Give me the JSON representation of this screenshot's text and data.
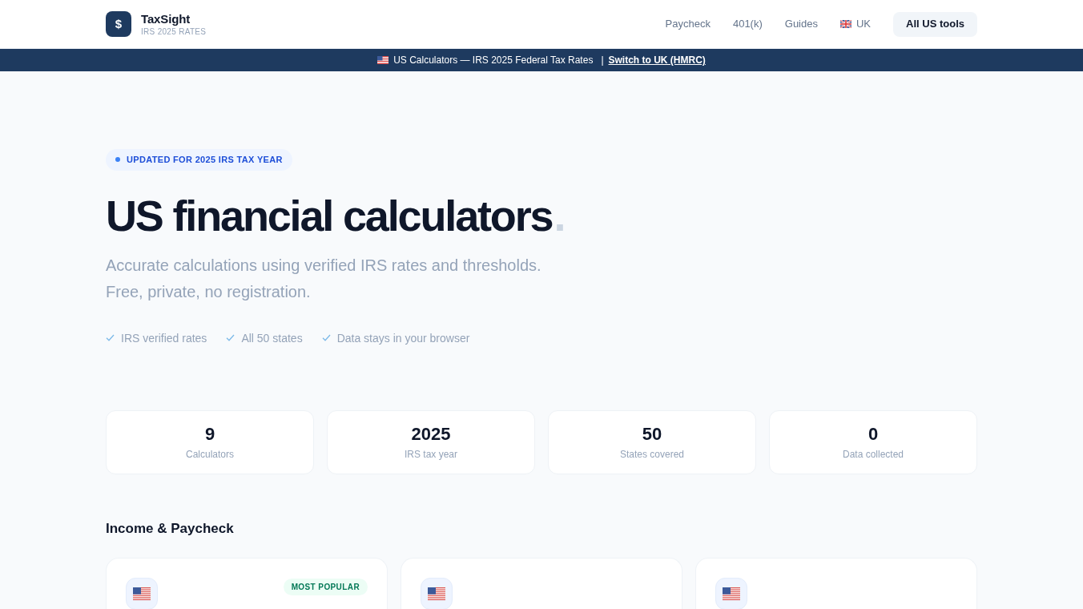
{
  "header": {
    "logo": {
      "symbol": "$",
      "name": "TaxSight",
      "tagline": "IRS 2025 RATES"
    },
    "nav": [
      {
        "label": "Paycheck",
        "kind": "link"
      },
      {
        "label": "401(k)",
        "kind": "link"
      },
      {
        "label": "Guides",
        "kind": "link"
      },
      {
        "label": "UK",
        "kind": "flag_link"
      },
      {
        "label": "All US tools",
        "kind": "button"
      }
    ]
  },
  "banner": {
    "text": "US Calculators — IRS 2025 Federal Tax Rates",
    "separator": "|",
    "link": "Switch to UK (HMRC)"
  },
  "hero": {
    "badge": "UPDATED FOR 2025 IRS TAX YEAR",
    "title": "US financial calculators",
    "title_end": ".",
    "subtitle": "Accurate calculations using verified IRS rates and thresholds. Free, private, no registration.",
    "features": [
      "IRS verified rates",
      "All 50 states",
      "Data stays in your browser"
    ]
  },
  "stats": [
    {
      "value": "9",
      "label": "Calculators"
    },
    {
      "value": "2025",
      "label": "IRS tax year"
    },
    {
      "value": "50",
      "label": "States covered"
    },
    {
      "value": "0",
      "label": "Data collected"
    }
  ],
  "sections": [
    {
      "title": "Income & Paycheck",
      "cards": [
        {
          "popular": true,
          "badge": "MOST POPULAR"
        },
        {
          "popular": false
        },
        {
          "popular": false
        }
      ]
    }
  ]
}
